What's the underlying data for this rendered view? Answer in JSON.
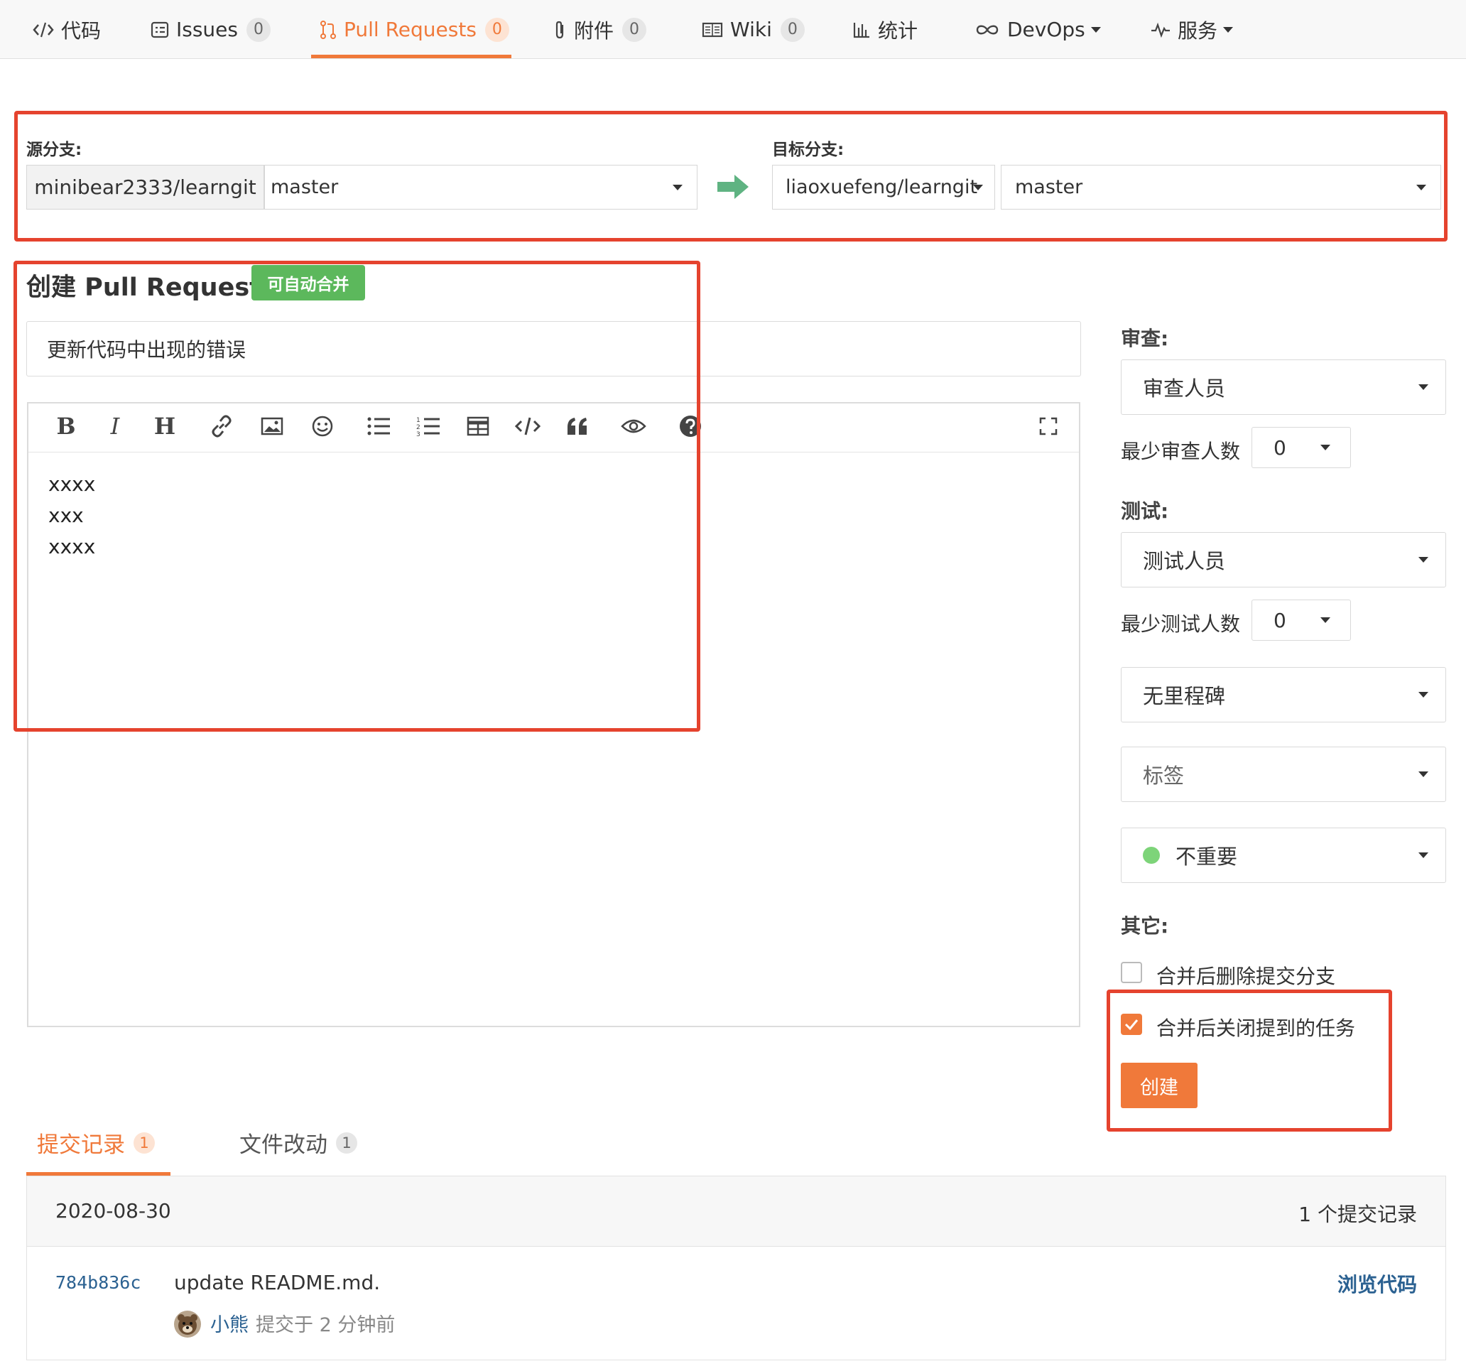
{
  "nav": {
    "items": [
      {
        "icon": "code-icon",
        "label": "代码"
      },
      {
        "icon": "issues-icon",
        "label": "Issues",
        "count": "0"
      },
      {
        "icon": "pull-request-icon",
        "label": "Pull Requests",
        "count": "0"
      },
      {
        "icon": "paperclip-icon",
        "label": "附件",
        "count": "0"
      },
      {
        "icon": "book-icon",
        "label": "Wiki",
        "count": "0"
      },
      {
        "icon": "bar-chart-icon",
        "label": "统计"
      },
      {
        "icon": "infinity-icon",
        "label": "DevOps"
      },
      {
        "icon": "pulse-icon",
        "label": "服务"
      }
    ]
  },
  "branches": {
    "source_label": "源分支:",
    "source_repo": "minibear2333/learngit",
    "source_branch": "master",
    "target_label": "目标分支:",
    "target_repo": "liaoxuefeng/learngit",
    "target_branch": "master"
  },
  "pr": {
    "heading": "创建 Pull Request",
    "merge_badge": "可自动合并",
    "title_value": "更新代码中出现的错误",
    "body_lines": [
      "xxxx",
      "xxx",
      "xxxx"
    ],
    "toolbar": {
      "bold": "B",
      "italic": "I",
      "heading": "H"
    }
  },
  "sidebar": {
    "review_label": "审查:",
    "reviewer_select": "审查人员",
    "min_reviewer_label": "最少审查人数",
    "min_reviewer_value": "0",
    "test_label": "测试:",
    "tester_select": "测试人员",
    "min_tester_label": "最少测试人数",
    "min_tester_value": "0",
    "milestone_select": "无里程碑",
    "labels_select": "标签",
    "priority_select": "不重要",
    "priority_color": "#7dd479",
    "other_label": "其它:",
    "delete_branch_label": "合并后删除提交分支",
    "delete_branch_checked": false,
    "close_tasks_label": "合并后关闭提到的任务",
    "close_tasks_checked": true,
    "create_button": "创建"
  },
  "tabs": [
    {
      "label": "提交记录",
      "count": "1",
      "active": true
    },
    {
      "label": "文件改动",
      "count": "1",
      "active": false
    }
  ],
  "commits": {
    "date": "2020-08-30",
    "summary": "1 个提交记录",
    "items": [
      {
        "hash": "784b836c",
        "message": "update README.md.",
        "author": "小熊",
        "meta": "提交于 2 分钟前",
        "browse": "浏览代码"
      }
    ]
  },
  "colors": {
    "accent": "#f0793a",
    "annotation": "#e5432e",
    "success": "#5cb85c",
    "link": "#2b6191"
  }
}
